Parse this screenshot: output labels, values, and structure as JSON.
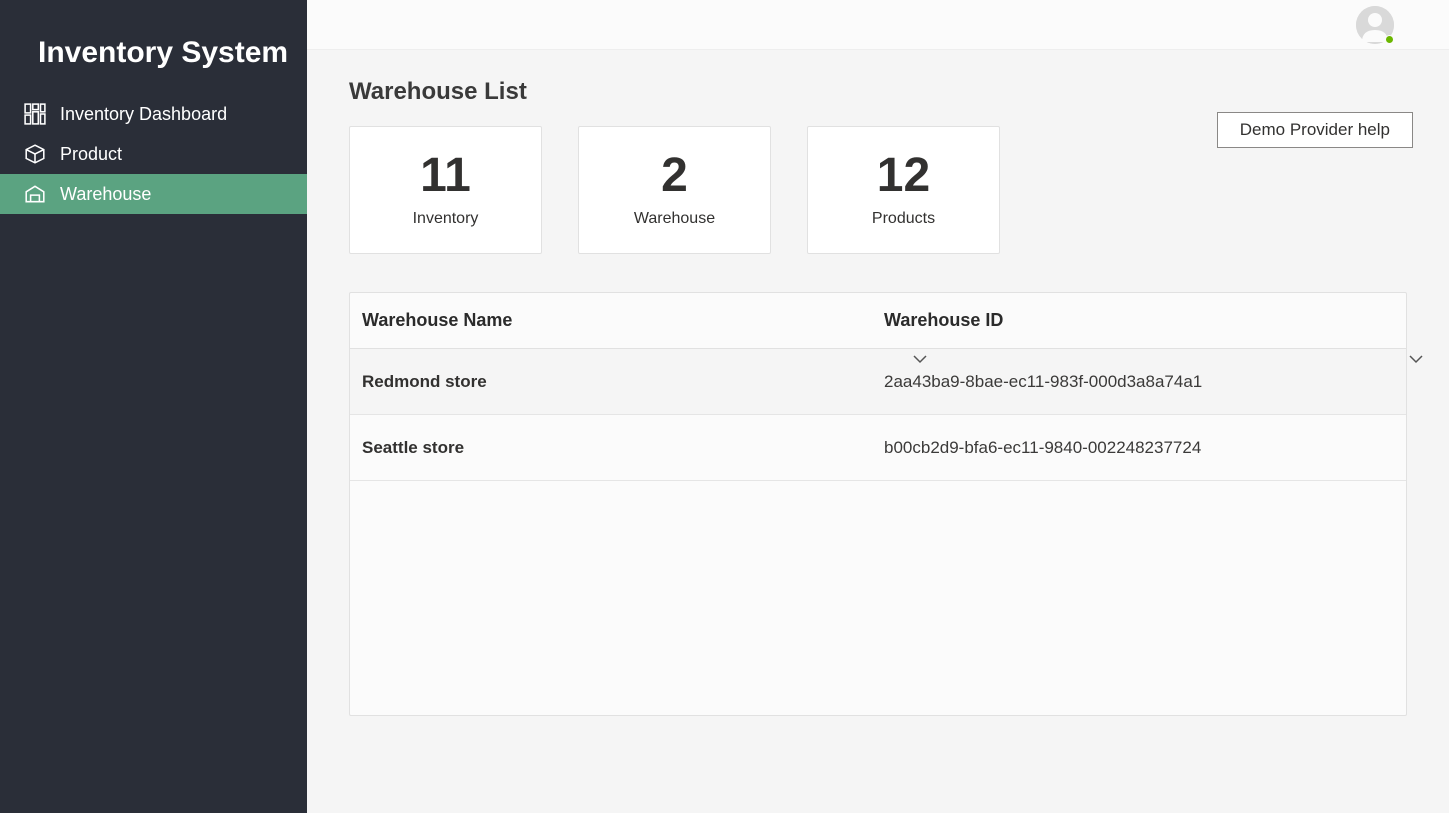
{
  "app": {
    "title": "Inventory System"
  },
  "sidebar": {
    "items": [
      {
        "label": "Inventory Dashboard",
        "id": "dashboard",
        "active": false
      },
      {
        "label": "Product",
        "id": "product",
        "active": false
      },
      {
        "label": "Warehouse",
        "id": "warehouse",
        "active": true
      }
    ]
  },
  "header": {
    "help_button": "Demo Provider help"
  },
  "page": {
    "title": "Warehouse List"
  },
  "cards": [
    {
      "value": "11",
      "label": "Inventory"
    },
    {
      "value": "2",
      "label": "Warehouse"
    },
    {
      "value": "12",
      "label": "Products"
    }
  ],
  "table": {
    "columns": [
      {
        "label": "Warehouse Name"
      },
      {
        "label": "Warehouse ID"
      }
    ],
    "rows": [
      {
        "name": "Redmond store",
        "id": "2aa43ba9-8bae-ec11-983f-000d3a8a74a1"
      },
      {
        "name": "Seattle store",
        "id": "b00cb2d9-bfa6-ec11-9840-002248237724"
      }
    ]
  }
}
